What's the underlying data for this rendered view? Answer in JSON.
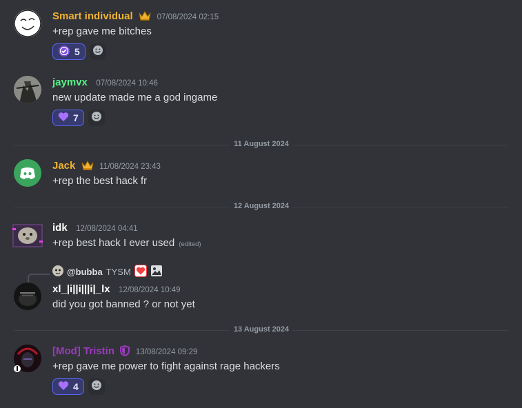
{
  "colors": {
    "background": "#313338",
    "gold_name": "#f0b232",
    "green_name": "#57f287",
    "white_name": "#ffffff",
    "mod_name": "#9b3bbd",
    "reaction_bg": "#373a6e",
    "reaction_border": "#5865f2"
  },
  "messages": [
    {
      "author": "Smart individual",
      "timestamp": "07/08/2024 02:15",
      "text": "+rep gave me bitches",
      "reactions": [
        {
          "emoji": "verified-check-icon",
          "count": "5"
        }
      ]
    },
    {
      "author": "jaymvx",
      "timestamp": "07/08/2024 10:46",
      "text": "new update made me a god ingame",
      "reactions": [
        {
          "emoji": "purple-heart-icon",
          "count": "7"
        }
      ]
    },
    {
      "author": "Jack",
      "timestamp": "11/08/2024 23:43",
      "text": "+rep the best hack fr"
    },
    {
      "author": "idk",
      "timestamp": "12/08/2024 04:41",
      "text": "+rep best hack I ever used",
      "edited": "(edited)"
    },
    {
      "reply_to": "@bubba",
      "reply_text": "TYSM",
      "author": "xl_|i||i|||i|_lx",
      "timestamp": "12/08/2024 10:49",
      "text": "did you got banned ? or not yet"
    },
    {
      "author": "[Mod] Tristin",
      "timestamp": "13/08/2024 09:29",
      "text": "+rep gave me power to fight against rage hackers",
      "reactions": [
        {
          "emoji": "purple-heart-icon",
          "count": "4"
        }
      ]
    }
  ],
  "dividers": [
    "11 August 2024",
    "12 August 2024",
    "13 August 2024"
  ]
}
